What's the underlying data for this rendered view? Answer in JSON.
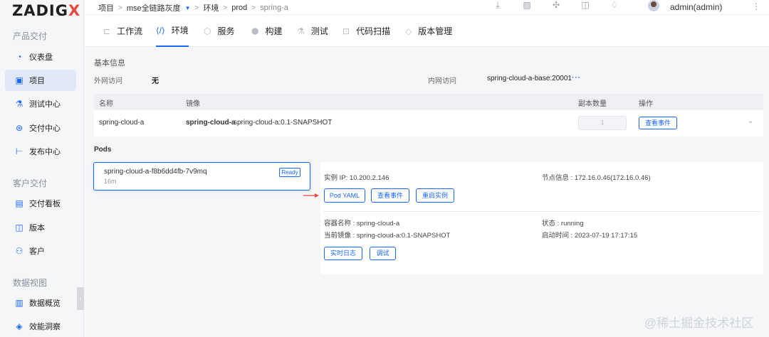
{
  "logo": {
    "text": "ZADIG",
    "accent": "X"
  },
  "sidebar": {
    "sections": [
      {
        "title": "产品交付",
        "items": [
          {
            "icon": "dashboard-icon",
            "label": "仪表盘"
          },
          {
            "icon": "project-icon",
            "label": "项目",
            "active": true
          },
          {
            "icon": "flask-icon",
            "label": "测试中心"
          },
          {
            "icon": "delivery-icon",
            "label": "交付中心"
          },
          {
            "icon": "release-icon",
            "label": "发布中心"
          }
        ]
      },
      {
        "title": "客户交付",
        "items": [
          {
            "icon": "board-icon",
            "label": "交付看板"
          },
          {
            "icon": "version-icon",
            "label": "版本"
          },
          {
            "icon": "customer-icon",
            "label": "客户"
          }
        ]
      },
      {
        "title": "数据视图",
        "items": [
          {
            "icon": "data-overview-icon",
            "label": "数据概览"
          },
          {
            "icon": "efficiency-icon",
            "label": "效能洞察"
          }
        ]
      }
    ]
  },
  "breadcrumb": {
    "items": [
      "项目",
      "mse全链路灰度",
      "环境",
      "prod",
      "spring-a"
    ],
    "sep": ">"
  },
  "header": {
    "user": "admin(admin)"
  },
  "tabs": [
    "工作流",
    "环境",
    "服务",
    "构建",
    "测试",
    "代码扫描",
    "版本管理"
  ],
  "active_tab": "环境",
  "basic_info": {
    "title": "基本信息",
    "external_label": "外网访问",
    "external_value": "无",
    "internal_label": "内网访问",
    "internal_value": "spring-cloud-a-base:20001",
    "more": "···"
  },
  "service_table": {
    "headers": [
      "名称",
      "镜像",
      "副本数量",
      "操作"
    ],
    "row": {
      "name": "spring-cloud-a",
      "image_name": "spring-cloud-a",
      "image_tag": "spring-cloud-a:0.1-SNAPSHOT",
      "replicas": "1",
      "action": "查看事件"
    }
  },
  "pods": {
    "title": "Pods",
    "pod": {
      "name": "spring-cloud-a-f8b6dd4fb-7v9mq",
      "age": "16m",
      "status": "Ready"
    },
    "detail": {
      "ip_label": "实例 IP:",
      "ip": "10.200.2.146",
      "node_label": "节点信息 :",
      "node": "172.16.0.46(172.16.0.46)",
      "buttons": [
        "Pod YAML",
        "查看事件",
        "重启实例"
      ],
      "container_label": "容器名称 :",
      "container": "spring-cloud-a",
      "state_label": "状态 :",
      "state": "running",
      "image_label": "当前镜像 :",
      "image": "spring-cloud-a:0.1-SNAPSHOT",
      "start_label": "启动时间 :",
      "start": "2023-07-19 17:17:15",
      "container_buttons": [
        "实时日志",
        "调试"
      ]
    }
  },
  "watermark": "@稀土掘金技术社区",
  "colors": {
    "accent": "#1a66ff",
    "logo_x": "#e64a3c",
    "arrow": "#e64a3c"
  }
}
